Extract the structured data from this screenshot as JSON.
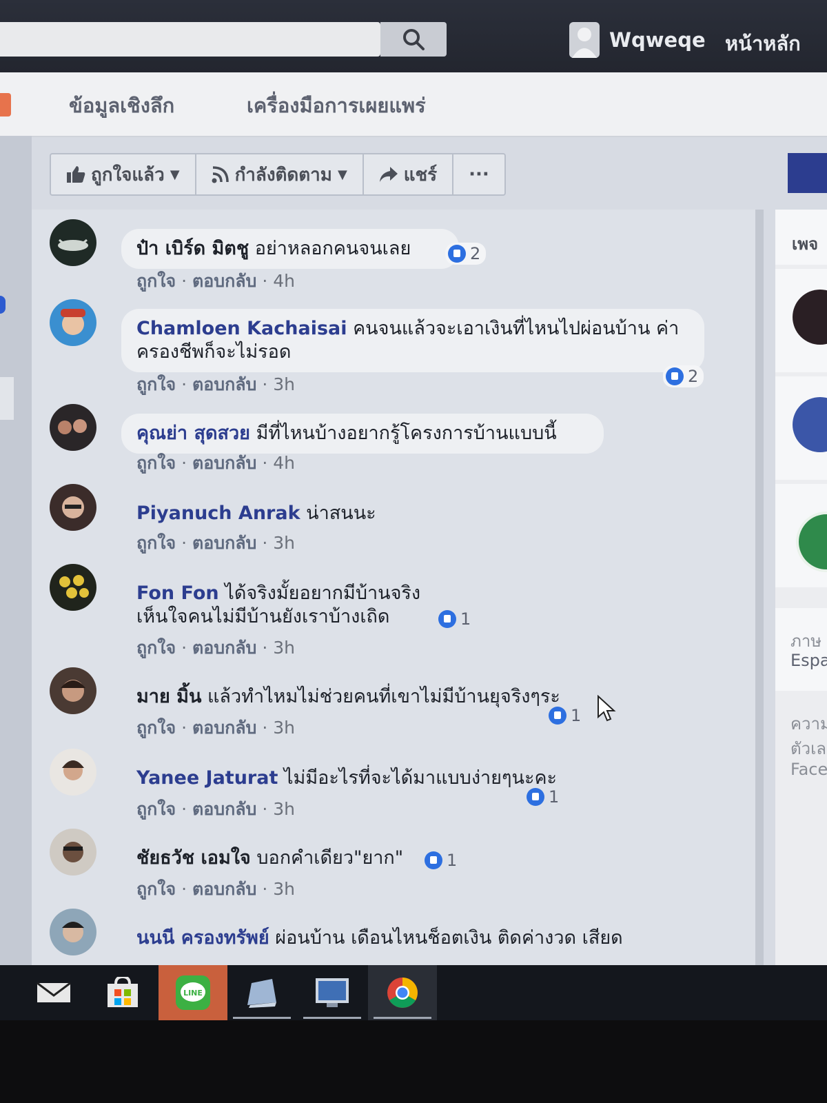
{
  "topbar": {
    "search_value": "",
    "user_name": "Wqweqe",
    "home_label": "หน้าหลัก"
  },
  "tabs": [
    "ข้อมูลเชิงลึก",
    "เครื่องมือการเผยแพร่"
  ],
  "actions": {
    "liked": "ถูกใจแล้ว",
    "following": "กำลังติดตาม",
    "share": "แชร์",
    "more": "···"
  },
  "comments": [
    {
      "name": "ป๋า เบิร์ด มิตชู",
      "text": "อย่าหลอกคนจนเลย",
      "meta": {
        "like": "ถูกใจ",
        "reply": "ตอบกลับ",
        "time": "4h"
      },
      "likes": "2"
    },
    {
      "name": "Chamloen Kachaisai",
      "text": "คนจนแล้วจะเอาเงินที่ไหนไปผ่อนบ้าน ค่าครองชีพก็จะไม่รอด",
      "meta": {
        "like": "ถูกใจ",
        "reply": "ตอบกลับ",
        "time": "3h"
      },
      "likes": "2"
    },
    {
      "name": "คุณย่า สุดสวย",
      "text": "มีที่ไหนบ้างอยากรู้โครงการบ้านแบบนี้",
      "meta": {
        "like": "ถูกใจ",
        "reply": "ตอบกลับ",
        "time": "4h"
      }
    },
    {
      "name": "Piyanuch Anrak",
      "text": "น่าสนนะ",
      "meta": {
        "like": "ถูกใจ",
        "reply": "ตอบกลับ",
        "time": "3h"
      }
    },
    {
      "name": "Fon Fon",
      "text": "ได้จริงมั้ยอยากมีบ้านจริง เห็นใจคนไม่มีบ้านยังเราบ้างเถิด",
      "meta": {
        "like": "ถูกใจ",
        "reply": "ตอบกลับ",
        "time": "3h"
      },
      "likes": "1"
    },
    {
      "name": "มาย มิ้น",
      "text": "แล้วทำไหมไม่ช่วยคนที่เขาไม่มีบ้านยุจริงๆระ",
      "meta": {
        "like": "ถูกใจ",
        "reply": "ตอบกลับ",
        "time": "3h"
      },
      "likes": "1"
    },
    {
      "name": "Yanee Jaturat",
      "text": "ไม่มีอะไรที่จะได้มาแบบง่ายๆนะคะ",
      "meta": {
        "like": "ถูกใจ",
        "reply": "ตอบกลับ",
        "time": "3h"
      },
      "likes": "1"
    },
    {
      "name": "ชัยธวัช เอมใจ",
      "text": "บอกคำเดียว\"ยาก\"",
      "meta": {
        "like": "ถูกใจ",
        "reply": "ตอบกลับ",
        "time": "3h"
      },
      "likes": "1"
    },
    {
      "name": "นนนี ครองทรัพย์",
      "text": "ผ่อนบ้าน เดือนไหนช็อตเงิน ติดค่างวด เสียด"
    }
  ],
  "sidebar": {
    "header": "เพจ",
    "lang_label": "ภาษ",
    "lang_value": "Espa",
    "footer": [
      "ความ",
      "ตัวเล",
      "Face"
    ]
  },
  "colors": {
    "brand_dark": "#23262f",
    "name_blue": "#2c3d8f",
    "like_blue": "#2d6fe0",
    "panel_bg": "#dde1e8"
  }
}
